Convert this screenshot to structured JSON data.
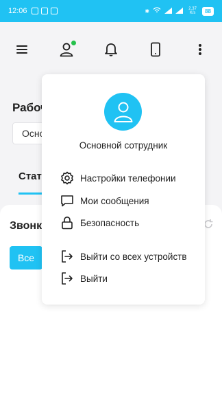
{
  "status_bar": {
    "time": "12:06",
    "battery": "88",
    "net_speed": "2.37 K/s"
  },
  "header": {
    "icons": [
      "menu-icon",
      "user-icon",
      "bell-icon",
      "phone-icon",
      "more-vertical-icon"
    ],
    "online_indicator_color": "#25c14b"
  },
  "background": {
    "page_title": "Рабоч",
    "select_value": "Осно",
    "tab_label": "Стат",
    "card_title": "Звонк",
    "filter_button": "Все"
  },
  "popup": {
    "user_name": "Основной сотрудник",
    "items": [
      {
        "label": "Настройки телефонии",
        "icon": "settings-icon"
      },
      {
        "label": "Мои сообщения",
        "icon": "message-icon"
      },
      {
        "label": "Безопасность",
        "icon": "lock-icon"
      },
      {
        "label": "Выйти со всех устройств",
        "icon": "logout-all-icon"
      },
      {
        "label": "Выйти",
        "icon": "logout-icon"
      }
    ]
  },
  "colors": {
    "accent": "#20c2f3",
    "background": "#f4f4f6",
    "surface": "#ffffff"
  }
}
